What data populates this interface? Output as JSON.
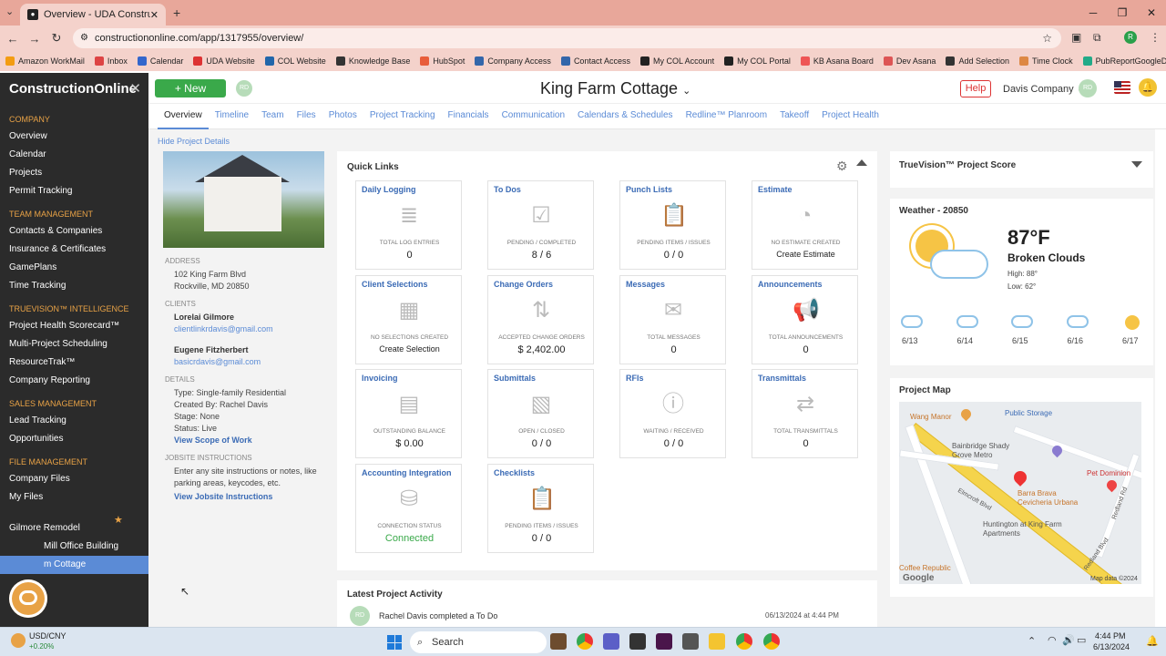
{
  "browser": {
    "tab_title": "Overview - UDA ConstructionO",
    "url": "constructiononline.com/app/1317955/overview/",
    "bookmarks": [
      "Amazon WorkMail",
      "Inbox",
      "Calendar",
      "UDA Website",
      "COL Website",
      "Knowledge Base",
      "HubSpot",
      "Company Access",
      "Contact Access",
      "My COL Account",
      "My COL Portal",
      "KB Asana Board",
      "Dev Asana",
      "Add Selection",
      "Time Clock",
      "PubReportGoogleDr..."
    ]
  },
  "sidebar": {
    "logo": "ConstructionOnline",
    "sections": [
      {
        "title": "COMPANY",
        "items": [
          "Overview",
          "Calendar",
          "Projects",
          "Permit Tracking"
        ]
      },
      {
        "title": "TEAM MANAGEMENT",
        "items": [
          "Contacts & Companies",
          "Insurance & Certificates",
          "GamePlans",
          "Time Tracking"
        ]
      },
      {
        "title": "TRUEVISION™ INTELLIGENCE",
        "items": [
          "Project Health Scorecard™",
          "Multi-Project Scheduling",
          "ResourceTrak™",
          "Company Reporting"
        ]
      },
      {
        "title": "SALES MANAGEMENT",
        "items": [
          "Lead Tracking",
          "Opportunities"
        ]
      },
      {
        "title": "FILE MANAGEMENT",
        "items": [
          "Company Files",
          "My Files"
        ]
      },
      {
        "title": "FAVORITES",
        "items": [
          "Gilmore Remodel",
          "Mill Office Building",
          "m Cottage"
        ]
      }
    ]
  },
  "header": {
    "new_label": "New",
    "avatar_initials": "RD",
    "project_title": "King Farm Cottage",
    "help_label": "Help",
    "company": "Davis Company"
  },
  "tabs": [
    "Overview",
    "Timeline",
    "Team",
    "Files",
    "Photos",
    "Project Tracking",
    "Financials",
    "Communication",
    "Calendars & Schedules",
    "Redline™ Planroom",
    "Takeoff",
    "Project Health"
  ],
  "details": {
    "hide_link": "Hide Project Details",
    "address_label": "ADDRESS",
    "address1": "102 King Farm Blvd",
    "address2": "Rockville, MD 20850",
    "clients_label": "CLIENTS",
    "client1_name": "Lorelai Gilmore",
    "client1_email": "clientlinkrdavis@gmail.com",
    "client2_name": "Eugene Fitzherbert",
    "client2_email": "basicrdavis@gmail.com",
    "details_label": "DETAILS",
    "type": "Type: Single-family Residential",
    "created_by": "Created By: Rachel Davis",
    "stage": "Stage: None",
    "status": "Status: Live",
    "scope_link": "View Scope of Work",
    "jobsite_label": "JOBSITE INSTRUCTIONS",
    "jobsite_text1": "Enter any site instructions or notes, like",
    "jobsite_text2": "parking areas, keycodes, etc.",
    "jobsite_link": "View Jobsite Instructions"
  },
  "quick_links": {
    "title": "Quick Links",
    "cards": [
      {
        "title": "Daily Logging",
        "label": "TOTAL LOG ENTRIES",
        "value": "0",
        "icon": "≣"
      },
      {
        "title": "To Dos",
        "label": "PENDING / COMPLETED",
        "value": "8 / 6",
        "icon": "☑"
      },
      {
        "title": "Punch Lists",
        "label": "PENDING ITEMS / ISSUES",
        "value": "0 / 0",
        "icon": "📋"
      },
      {
        "title": "Estimate",
        "label": "NO ESTIMATE CREATED",
        "value": "Create Estimate",
        "icon": "◔"
      },
      {
        "title": "Client Selections",
        "label": "NO SELECTIONS CREATED",
        "value": "Create Selection",
        "icon": "▦"
      },
      {
        "title": "Change Orders",
        "label": "ACCEPTED CHANGE ORDERS",
        "value": "$ 2,402.00",
        "icon": "⇅"
      },
      {
        "title": "Messages",
        "label": "TOTAL MESSAGES",
        "value": "0",
        "icon": "✉"
      },
      {
        "title": "Announcements",
        "label": "TOTAL ANNOUNCEMENTS",
        "value": "0",
        "icon": "📢"
      },
      {
        "title": "Invoicing",
        "label": "OUTSTANDING BALANCE",
        "value": "$ 0.00",
        "icon": "▤"
      },
      {
        "title": "Submittals",
        "label": "OPEN / CLOSED",
        "value": "0 / 0",
        "icon": "▧"
      },
      {
        "title": "RFIs",
        "label": "WAITING / RECEIVED",
        "value": "0 / 0",
        "icon": "ⓘ"
      },
      {
        "title": "Transmittals",
        "label": "TOTAL TRANSMITTALS",
        "value": "0",
        "icon": "⇄"
      },
      {
        "title": "Accounting Integration",
        "label": "CONNECTION STATUS",
        "value": "Connected",
        "icon": "⛁"
      },
      {
        "title": "Checklists",
        "label": "PENDING ITEMS / ISSUES",
        "value": "0 / 0",
        "icon": "📋"
      }
    ]
  },
  "activity": {
    "title": "Latest Project Activity",
    "item_text": "Rachel Davis completed a To Do",
    "item_date": "06/13/2024 at 4:44 PM"
  },
  "truevision": {
    "title": "TrueVision™ Project Score"
  },
  "weather": {
    "title": "Weather - 20850",
    "temp": "87°F",
    "condition": "Broken Clouds",
    "high": "High: 88°",
    "low": "Low: 62°",
    "forecast": [
      "6/13",
      "6/14",
      "6/15",
      "6/16",
      "6/17"
    ]
  },
  "map": {
    "title": "Project Map",
    "labels": [
      "Wang Manor",
      "Public Storage",
      "Bainbridge Shady Grove Metro",
      "Pet Dominion",
      "Barra Brava Cevicheria Urbana",
      "Huntington at King Farm Apartments",
      "Coffee Republic",
      "Elmcroft Blvd",
      "Redland Rd",
      "Redland Blvd"
    ],
    "copyright": "Map data ©2024"
  },
  "taskbar": {
    "ticker_title": "USD/CNY",
    "ticker_value": "+0.20%",
    "search": "Search",
    "time": "4:44 PM",
    "date": "6/13/2024"
  }
}
